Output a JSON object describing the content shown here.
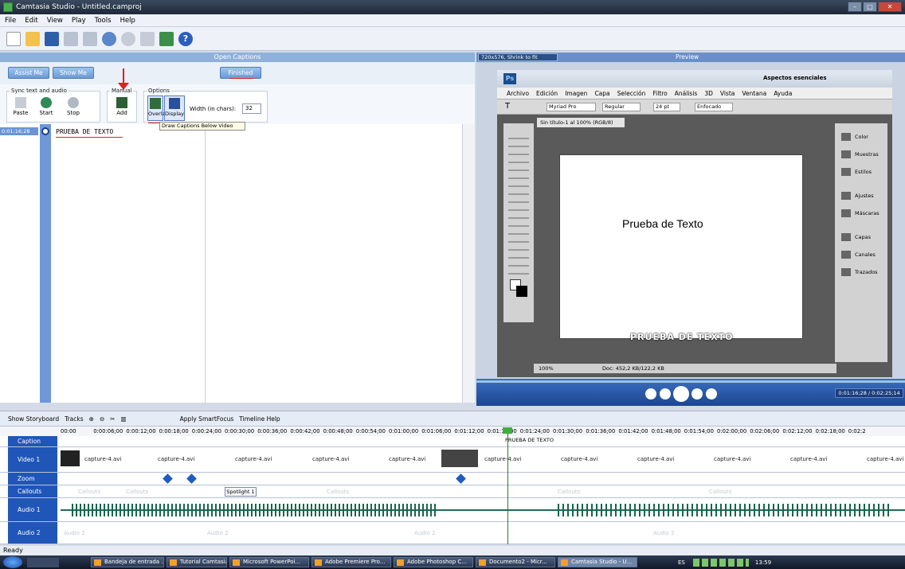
{
  "window": {
    "title": "Camtasia Studio - Untitled.camproj"
  },
  "menu": [
    "File",
    "Edit",
    "View",
    "Play",
    "Tools",
    "Help"
  ],
  "captions_panel": {
    "title": "Open Captions",
    "assist_me": "Assist Me",
    "show_me": "Show Me",
    "finished": "Finished",
    "sync_group": "Sync text and audio",
    "paste": "Paste",
    "start": "Start",
    "stop": "Stop",
    "manual_group": "Manual",
    "add": "Add",
    "options_group": "Options",
    "overlay": "Overlay",
    "display": "Display",
    "width_label": "Width (in chars):",
    "width_value": "32",
    "tooltip": "Draw Captions Below Video",
    "caption_time": "0:01:16;28",
    "caption_text": "PRUEBA DE TEXTO"
  },
  "preview": {
    "size_select": "720x576, Shrink to fit",
    "title": "Preview",
    "time": "0:01:16;28 / 0:02:25;14",
    "overlay_caption": "PRUEBA DE TEXTO"
  },
  "photoshop": {
    "workspace": "Aspectos esenciales",
    "menus": [
      "Archivo",
      "Edición",
      "Imagen",
      "Capa",
      "Selección",
      "Filtro",
      "Análisis",
      "3D",
      "Vista",
      "Ventana",
      "Ayuda"
    ],
    "font": "Myriad Pro",
    "style": "Regular",
    "size": "24 pt",
    "aa": "Enfocado",
    "zoom_pct": "100%",
    "tab": "Sin título-1 al 100% (RGB/8)",
    "canvas_text": "Prueba de Texto",
    "zoom": "100%",
    "doc": "Doc: 452,2 KB/122,2 KB",
    "panels": [
      "Color",
      "Muestras",
      "Estilos",
      "Ajustes",
      "Máscaras",
      "Capas",
      "Canales",
      "Trazados"
    ]
  },
  "timeline": {
    "show_storyboard": "Show Storyboard",
    "tracks": "Tracks",
    "apply_smartfocus": "Apply SmartFocus",
    "timeline_help": "Timeline Help",
    "ruler": [
      "00:00",
      "0:00:06;00",
      "0:00:12;00",
      "0:00:18;00",
      "0:00:24;00",
      "0:00:30;00",
      "0:00:36;00",
      "0:00:42;00",
      "0:00:48;00",
      "0:00:54;00",
      "0:01:00;00",
      "0:01:06;00",
      "0:01:12;00",
      "0:01:18;00",
      "0:01:24;00",
      "0:01:30;00",
      "0:01:36;00",
      "0:01:42;00",
      "0:01:48;00",
      "0:01:54;00",
      "0:02:00;00",
      "0:02:06;00",
      "0:02:12;00",
      "0:02:18;00",
      "0:02:2"
    ],
    "tracks_list": {
      "caption": "Caption",
      "video1": "Video 1",
      "zoom": "Zoom",
      "callouts": "Callouts",
      "audio1": "Audio 1",
      "audio2": "Audio 2"
    },
    "caption_clip": "PRUEBA DE TEXTO",
    "clip_name": "capture-4.avi",
    "spotlight": "Spotlight 1",
    "callouts_ghost": "Callouts",
    "audio2_ghost": "Audio 2"
  },
  "status": "Ready",
  "taskbar": {
    "items": [
      "Bandeja de entrada ...",
      "Tutorial Camtasia",
      "Microsoft PowerPoi...",
      "Adobe Premiere Pro...",
      "Adobe Photoshop C...",
      "Documento2 - Micr...",
      "Camtasia Studio - U..."
    ],
    "lang": "ES",
    "clock": "13:59"
  }
}
